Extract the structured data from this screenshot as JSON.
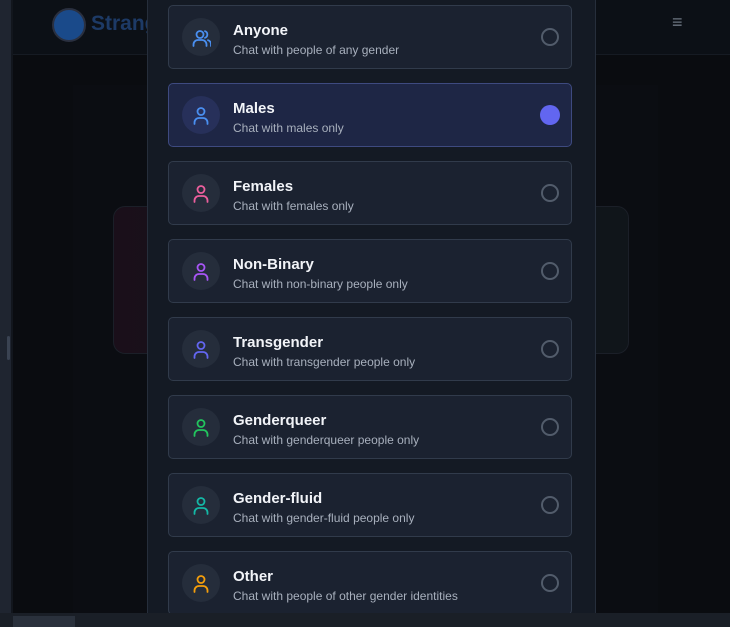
{
  "background": {
    "brand": "Strang",
    "menu_icon": "≡"
  },
  "options": [
    {
      "title": "Anyone",
      "desc": "Chat with people of any gender",
      "icon": "users-icon",
      "color": "#4a8ff0",
      "selected": false
    },
    {
      "title": "Males",
      "desc": "Chat with males only",
      "icon": "user-icon",
      "color": "#4a8ff0",
      "selected": true
    },
    {
      "title": "Females",
      "desc": "Chat with females only",
      "icon": "user-icon",
      "color": "#ec5f9d",
      "selected": false
    },
    {
      "title": "Non-Binary",
      "desc": "Chat with non-binary people only",
      "icon": "user-icon",
      "color": "#a855f7",
      "selected": false
    },
    {
      "title": "Transgender",
      "desc": "Chat with transgender people only",
      "icon": "user-icon",
      "color": "#6366f1",
      "selected": false
    },
    {
      "title": "Genderqueer",
      "desc": "Chat with genderqueer people only",
      "icon": "user-icon",
      "color": "#22c55e",
      "selected": false
    },
    {
      "title": "Gender-fluid",
      "desc": "Chat with gender-fluid people only",
      "icon": "user-icon",
      "color": "#14b8a6",
      "selected": false
    },
    {
      "title": "Other",
      "desc": "Chat with people of other gender identities",
      "icon": "user-icon",
      "color": "#f59e0b",
      "selected": false
    }
  ],
  "accent": "#6266f0"
}
